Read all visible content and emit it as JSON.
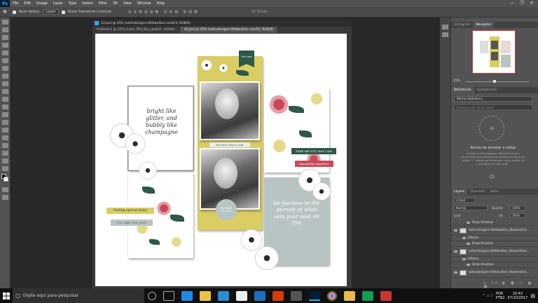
{
  "app": {
    "logo": "Ps",
    "menus": [
      "File",
      "Edit",
      "Image",
      "Layer",
      "Type",
      "Select",
      "Filter",
      "3D",
      "View",
      "Window",
      "Help"
    ],
    "window_controls": [
      "—",
      "❐",
      "✕"
    ]
  },
  "options": {
    "auto_select_label": "Auto-Select:",
    "auto_select_value": "Layer",
    "transform_label": "Show Transform Controls",
    "mode_label": "3D Mode:"
  },
  "document": {
    "window_title": "LO.psd @ 25% (sahindesigns-littlebullion-card13, RGB/8)",
    "tabs": [
      "Untitled-1 @ 25% (Love_This_Boy_web21, RGB/8)",
      "LO.psd @ 25% (sahindesigns-littlebullion-card13, RGB/8)"
    ]
  },
  "layout_text": {
    "card_script": "bright like glitter, and bubbly like champagne",
    "you_are": "You are",
    "because": "because this is real",
    "take_me": "TAKE ME YOU WAY I AM",
    "beautifully": "beautifully imperfect",
    "feeling": "Feeling special today",
    "the_one": "YOU ARE THE ONE!",
    "be_true": "BE TRUE TO YOU",
    "fearless": "be fearless in the pursuit of what sets your soul on fire"
  },
  "right_panel": {
    "nav_tabs": [
      "Histogram",
      "Navigator"
    ],
    "zoom": "25%",
    "lib_tabs": [
      "Bibliotecas",
      "Ajustamento"
    ],
    "library_select": "Minha biblioteca",
    "search_placeholder": "Pesquisar em Adobe Stock",
    "drop_title": "Ativos de arrastar e soltar",
    "drop_desc": "Arraste e solte qualquer elemento em seu documento para adicionar um gráfico ou clique no botão \"+\" abaixo para adicionar cores, estilos de caracteres e muito mais.",
    "layers_tabs": [
      "Layers",
      "Channels",
      "Paths"
    ],
    "kind": "Kind",
    "blend": "Normal",
    "opacity_label": "Opacity:",
    "opacity": "100%",
    "lock_label": "Lock:",
    "fill_label": "Fill:",
    "fill": "100%",
    "layers": [
      {
        "name": "Drop Shadow",
        "type": "effect"
      },
      {
        "name": "sahindesigns-littlebullion_flowerstick...",
        "type": "layer"
      },
      {
        "name": "Effects",
        "type": "effect"
      },
      {
        "name": "Drop Shadow",
        "type": "effect"
      },
      {
        "name": "sahindesigns-littlebullion_flowerstick...",
        "type": "layer"
      },
      {
        "name": "Effects",
        "type": "effect"
      },
      {
        "name": "Drop Shadow",
        "type": "effect"
      },
      {
        "name": "sahindesigns-littlebullion_flowerstick...",
        "type": "layer"
      }
    ]
  },
  "taskbar": {
    "search_text": "Digite aqui para pesquisar",
    "lang": "POR",
    "kbd": "PTB2",
    "time": "20:42",
    "date": "07/10/2017"
  },
  "colors": {
    "ps_blue": "#31a8ff",
    "forest": "#2f5848",
    "mustard": "#d9cd64",
    "slate": "#b8c4c4",
    "rose": "#c84a5a"
  }
}
